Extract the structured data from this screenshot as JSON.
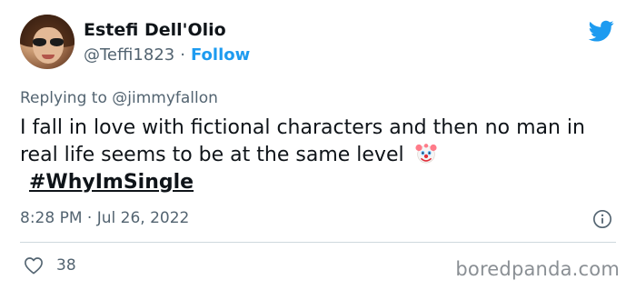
{
  "author": {
    "name": "Estefi Dell'Olio",
    "handle": "@Teffi1823",
    "separator": "·",
    "follow_label": "Follow"
  },
  "reply": {
    "prefix": "Replying to",
    "mention": "@jimmyfallon"
  },
  "tweet": {
    "text": "I fall in love with fictional characters and then no man in real life seems to be at the same level",
    "emoji": "clown-face-emoji",
    "hashtag": "#WhyImSingle",
    "timestamp": "8:28 PM · Jul 26, 2022"
  },
  "engagement": {
    "likes": "38"
  },
  "watermark": "boredpanda.com",
  "colors": {
    "twitter_blue": "#1d9bf0",
    "secondary_text": "#536471",
    "primary_text": "#0f1419"
  },
  "icons": {
    "logo": "twitter-bird-icon",
    "info": "info-icon",
    "like": "heart-icon"
  }
}
